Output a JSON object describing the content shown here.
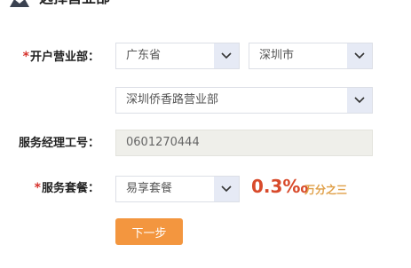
{
  "header": {
    "title": "选择营业部",
    "icon": "user-icon"
  },
  "form": {
    "branch_label": "开户营业部：",
    "province": "广东省",
    "city": "深圳市",
    "branch": "深圳侨香路营业部",
    "manager_label": "服务经理工号：",
    "manager_id": "0601270444",
    "package_label": "服务套餐：",
    "package": "易享套餐",
    "rate": "0.3‰",
    "rate_note": "万分之三",
    "required_mark": "*"
  },
  "actions": {
    "next_label": "下一步"
  },
  "colors": {
    "accent": "#f3963f",
    "required": "#d6322c",
    "rate": "#d84a2b",
    "rate_note": "#e0a049"
  }
}
